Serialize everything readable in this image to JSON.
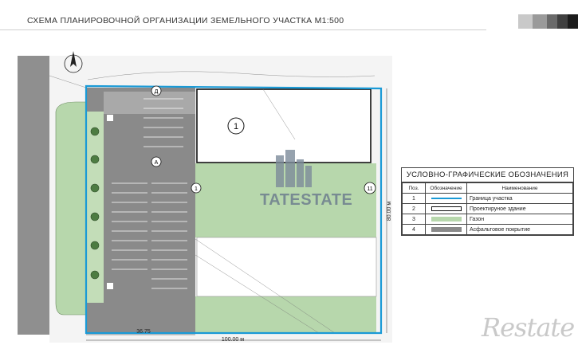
{
  "header": {
    "title": "СХЕМА ПЛАНИРОВОЧНОЙ ОРГАНИЗАЦИИ ЗЕМЕЛЬНОГО УЧАСТКА М1:500",
    "swatches": [
      "#c9c9c9",
      "#9a9a9a",
      "#6a6a6a",
      "#404040",
      "#1c1c1c"
    ]
  },
  "plan": {
    "colors": {
      "asphalt": "#8a8a8a",
      "lawn": "#b7d7ac",
      "boundary": "#1a9ad6",
      "building": "#ffffff"
    },
    "building_labels": [
      "1"
    ],
    "axis_labels": {
      "a": "Д",
      "b": "А",
      "c": "1",
      "d": "11"
    },
    "dimensions": {
      "left": "36.75",
      "bottom": "100.00 м",
      "right": "80.00 м"
    },
    "watermark": "TATESTATE"
  },
  "legend": {
    "title": "УСЛОВНО-ГРАФИЧЕСКИЕ ОБОЗНАЧЕНИЯ",
    "headers": [
      "Поз.",
      "Обозначение",
      "Наименование"
    ],
    "rows": [
      {
        "pos": "1",
        "name": "Граница участка",
        "symbol": "boundary"
      },
      {
        "pos": "2",
        "name": "Проектируное здание",
        "symbol": "building"
      },
      {
        "pos": "3",
        "name": "Газон",
        "symbol": "lawn"
      },
      {
        "pos": "4",
        "name": "Асфальтовое покрытие",
        "symbol": "asphalt"
      }
    ]
  },
  "brand": "Restate"
}
